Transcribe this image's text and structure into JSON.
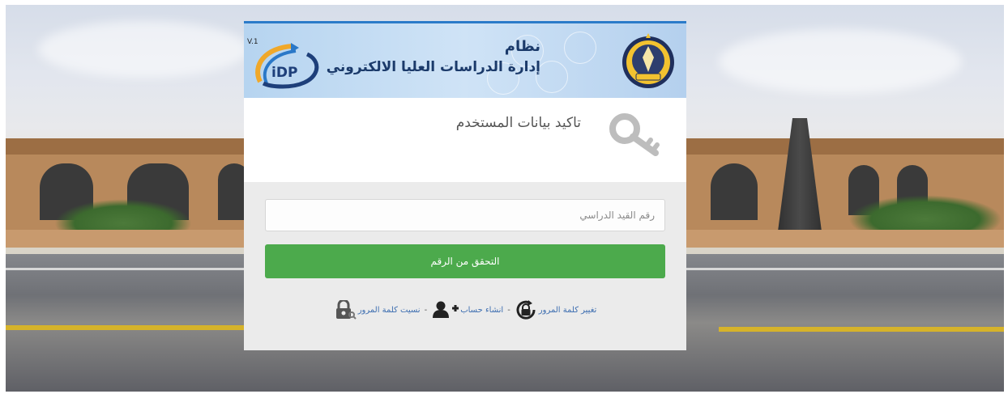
{
  "banner": {
    "version": "V.1",
    "logo_text": "iDP",
    "title_line1": "نظام",
    "title_line2": "إدارة الدراسات العليا الالكتروني"
  },
  "page": {
    "title": "تاكيد بيانات المستخدم"
  },
  "form": {
    "registration_placeholder": "رقم القيد الدراسي",
    "verify_button_label": "التحقق من الرقم"
  },
  "links": {
    "forgot_password": "نسيت كلمة المرور",
    "separator": "-",
    "create_account": "انشاء حساب",
    "change_password": "تغيير كلمة المرور"
  },
  "colors": {
    "primary_button": "#4caa4c",
    "banner_border": "#2b7bc9",
    "link": "#3c6db0"
  },
  "icons": [
    "key-icon",
    "lock-key-icon",
    "add-user-icon",
    "lock-rotate-icon",
    "idp-logo",
    "university-emblem"
  ]
}
